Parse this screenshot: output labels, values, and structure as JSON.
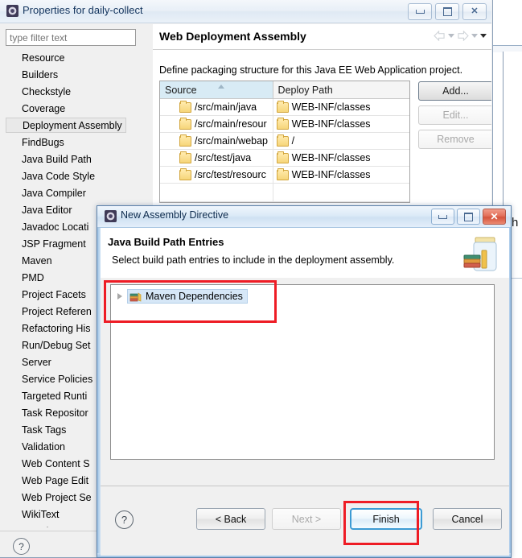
{
  "properties_window": {
    "title": "Properties for daily-collect",
    "title_icon": "eclipse-icon",
    "window_buttons": {
      "minimize": "minimize-icon",
      "maximize": "maximize-icon",
      "close": "close-icon"
    },
    "filter": {
      "placeholder": "type filter text",
      "value": ""
    },
    "tree_items": [
      {
        "label": "Resource",
        "selected": false
      },
      {
        "label": "Builders",
        "selected": false
      },
      {
        "label": "Checkstyle",
        "selected": false
      },
      {
        "label": "Coverage",
        "selected": false
      },
      {
        "label": "Deployment Assembly",
        "selected": true
      },
      {
        "label": "FindBugs",
        "selected": false
      },
      {
        "label": "Java Build Path",
        "selected": false
      },
      {
        "label": "Java Code Style",
        "selected": false
      },
      {
        "label": "Java Compiler",
        "selected": false
      },
      {
        "label": "Java Editor",
        "selected": false
      },
      {
        "label": "Javadoc Locati",
        "selected": false
      },
      {
        "label": "JSP Fragment",
        "selected": false
      },
      {
        "label": "Maven",
        "selected": false
      },
      {
        "label": "PMD",
        "selected": false
      },
      {
        "label": "Project Facets",
        "selected": false
      },
      {
        "label": "Project Referen",
        "selected": false
      },
      {
        "label": "Refactoring His",
        "selected": false
      },
      {
        "label": "Run/Debug Set",
        "selected": false
      },
      {
        "label": "Server",
        "selected": false
      },
      {
        "label": "Service Policies",
        "selected": false
      },
      {
        "label": "Targeted Runti",
        "selected": false
      },
      {
        "label": "Task Repositor",
        "selected": false
      },
      {
        "label": "Task Tags",
        "selected": false
      },
      {
        "label": "Validation",
        "selected": false
      },
      {
        "label": "Web Content S",
        "selected": false
      },
      {
        "label": "Web Page Edit",
        "selected": false
      },
      {
        "label": "Web Project Se",
        "selected": false
      },
      {
        "label": "WikiText",
        "selected": false
      },
      {
        "label": "XDoclet",
        "selected": false
      }
    ],
    "help_glyph": "?",
    "page": {
      "title": "Web Deployment Assembly",
      "description": "Define packaging structure for this Java EE Web Application project.",
      "nav": {
        "back": "back-arrow-icon",
        "back_menu": "chevron-down-icon",
        "forward": "forward-arrow-icon",
        "forward_menu": "chevron-down-icon",
        "view_menu": "chevron-down-icon"
      },
      "table": {
        "columns": [
          "Source",
          "Deploy Path"
        ],
        "rows": [
          {
            "source": "/src/main/java",
            "deploy": "WEB-INF/classes"
          },
          {
            "source": "/src/main/resour",
            "deploy": "WEB-INF/classes"
          },
          {
            "source": "/src/main/webap",
            "deploy": "/"
          },
          {
            "source": "/src/test/java",
            "deploy": "WEB-INF/classes"
          },
          {
            "source": "/src/test/resourc",
            "deploy": "WEB-INF/classes"
          }
        ]
      },
      "buttons": [
        {
          "label": "Add...",
          "enabled": true
        },
        {
          "label": "Edit...",
          "enabled": false
        },
        {
          "label": "Remove",
          "enabled": false
        }
      ]
    }
  },
  "dialog": {
    "title": "New Assembly Directive",
    "title_icon": "eclipse-icon",
    "window_buttons": {
      "minimize": "minimize-icon",
      "maximize": "maximize-icon",
      "close": "close-icon"
    },
    "heading": "Java Build Path Entries",
    "subheading": "Select build path entries to include in the deployment assembly.",
    "banner_icon": "jar-with-books-icon",
    "tree": [
      {
        "label": "Maven Dependencies",
        "icon": "books-icon",
        "selected": true,
        "expanded": false
      }
    ],
    "help_glyph": "?",
    "buttons": [
      {
        "label": "< Back",
        "enabled": true,
        "focused": false
      },
      {
        "label": "Next >",
        "enabled": false,
        "focused": false
      },
      {
        "label": "Finish",
        "enabled": true,
        "focused": true
      },
      {
        "label": "Cancel",
        "enabled": true,
        "focused": false
      }
    ]
  },
  "annotations": {
    "highlight_color": "#ee1c25",
    "boxes": [
      "maven-dependencies-tree-item",
      "finish-button"
    ]
  },
  "background": {
    "partial_text": "h"
  }
}
